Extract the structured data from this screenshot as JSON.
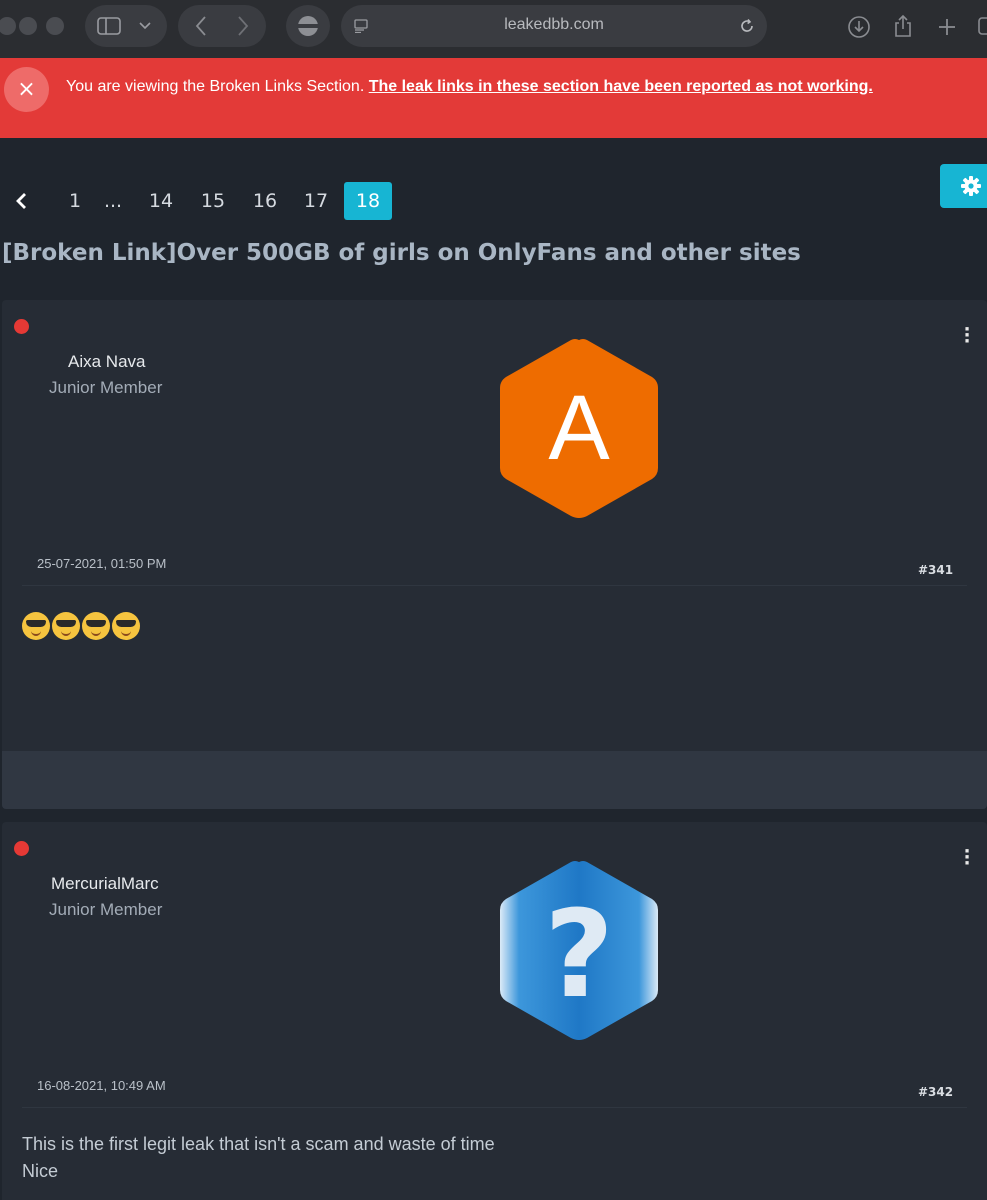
{
  "browser": {
    "url": "leakedbb.com"
  },
  "banner": {
    "close_icon": "×",
    "message": "You are viewing the Broken Links Section. ",
    "link_text": "The leak links in these section have been reported as not working."
  },
  "pagination": {
    "prev_icon": "‹",
    "pages": [
      "1",
      "...",
      "14",
      "15",
      "16",
      "17",
      "18"
    ],
    "active": "18",
    "settings_icon": "gear-icon"
  },
  "thread": {
    "title": "[Broken Link]Over 500GB of girls on OnlyFans and other sites"
  },
  "posts": [
    {
      "username": "Aixa Nava",
      "user_title": "Junior Member",
      "avatar_letter": "A",
      "avatar_color": "#ee6c00",
      "date": "25-07-2021, 01:50 PM",
      "post_number": "#341",
      "body_emoji": [
        "sunglasses-emoji",
        "sunglasses-emoji",
        "sunglasses-emoji",
        "sunglasses-emoji"
      ]
    },
    {
      "username": "MercurialMarc",
      "user_title": "Junior Member",
      "avatar_letter": "?",
      "avatar_color": "#2b86cf",
      "date": "16-08-2021, 10:49 AM",
      "post_number": "#342",
      "body_lines": [
        "This is the first legit leak that isn't a scam and waste of time",
        "Nice"
      ]
    }
  ]
}
